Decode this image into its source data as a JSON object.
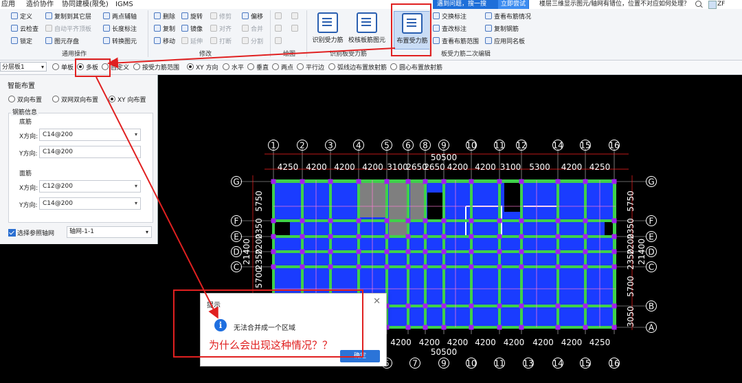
{
  "menubar": {
    "items": [
      "应用",
      "造价协作",
      "协同建模(限免)",
      "IGMS"
    ],
    "search_hint": "遇到问题，搜一搜",
    "try_button": "立即尝试",
    "faq": "楼层三维显示图元/轴网有错位，位置不对应如何处理？",
    "user": "ZF"
  },
  "ribbon": {
    "general_ops": {
      "label": "通用操作",
      "items": [
        "定义",
        "复制到其它层",
        "两点辅轴",
        "云检查",
        "自动平齐顶板",
        "长度标注",
        "锁定",
        "图元存盘",
        "转换图元"
      ]
    },
    "modify": {
      "label": "修改",
      "items": [
        "删除",
        "旋转",
        "修剪",
        "偏移",
        "复制",
        "镜像",
        "对齐",
        "合并",
        "移动",
        "延伸",
        "打断",
        "分割"
      ]
    },
    "draw": {
      "label": "绘图"
    },
    "slab_rebar": {
      "label": "识别板受力筋",
      "buttons": [
        "识别受力筋",
        "校核板筋图元",
        "布置受力筋"
      ]
    },
    "secondary_edit": {
      "label": "板受力筋二次编辑",
      "items": [
        "交换标注",
        "查看布筋情况",
        "查改标注",
        "复制钢筋",
        "查看布筋范围",
        "应用同名板"
      ]
    }
  },
  "optbar": {
    "layer": "分层板1",
    "layout_options": [
      "单板",
      "多板",
      "自定义",
      "按受力筋范围"
    ],
    "selected_layout": "多板",
    "direction_options": [
      "XY 方向",
      "水平",
      "垂直",
      "两点",
      "平行边",
      "弧线边布置放射筋",
      "圆心布置放射筋"
    ],
    "selected_direction": "XY 方向"
  },
  "panel": {
    "title": "智能布置",
    "modes": [
      "双向布置",
      "双网双向布置",
      "XY 向布置"
    ],
    "selected_mode": "XY 向布置",
    "rebar_info": "钢筋信息",
    "bottom": {
      "label": "底筋",
      "x_label": "X方向:",
      "x_value": "C14@200",
      "y_label": "Y方向:",
      "y_value": "C14@200"
    },
    "top": {
      "label": "面筋",
      "x_label": "X方向:",
      "x_value": "C12@200",
      "y_label": "Y方向:",
      "y_value": "C14@200"
    },
    "axis_checkbox": "选择参照轴网",
    "axis_value": "轴网-1-1"
  },
  "cad": {
    "top_axes": [
      "1",
      "2",
      "3",
      "4",
      "5",
      "6",
      "8",
      "9",
      "10",
      "11",
      "12",
      "14",
      "15",
      "16"
    ],
    "bottom_axes": [
      "5",
      "7",
      "9",
      "10",
      "11",
      "13",
      "14",
      "15",
      "16"
    ],
    "top_total": "50500",
    "bottom_total": "50500",
    "top_dims": [
      "4250",
      "4200",
      "4200",
      "4200",
      "3100",
      "2650",
      "2650",
      "4200",
      "4200",
      "3100",
      "5300",
      "4200",
      "4250"
    ],
    "bottom_dims": [
      "4200",
      "4200",
      "4200",
      "4200",
      "4200",
      "4200",
      "4200",
      "4250"
    ],
    "left_axes": [
      "G",
      "F",
      "E",
      "D",
      "C"
    ],
    "right_axes": [
      "G",
      "F",
      "E",
      "D",
      "C",
      "B",
      "A"
    ],
    "left_dims": [
      "5750",
      "2350",
      "2200",
      "2350",
      "5700"
    ],
    "left_total": "21400",
    "right_dims": [
      "5750",
      "2350",
      "2200",
      "2350",
      "5700",
      "3050"
    ],
    "right_total": "21400",
    "colors": {
      "slab": "#1a3cff",
      "beam": "#3fd14a",
      "node": "#a020f0",
      "grid": "#ffffff",
      "red_line": "#ff2020",
      "annotation": "#e02020"
    }
  },
  "dialog": {
    "title": "提示",
    "message": "无法合并成一个区域",
    "ok": "确定"
  },
  "annotation": {
    "question": "为什么会出现这种情况？？"
  }
}
